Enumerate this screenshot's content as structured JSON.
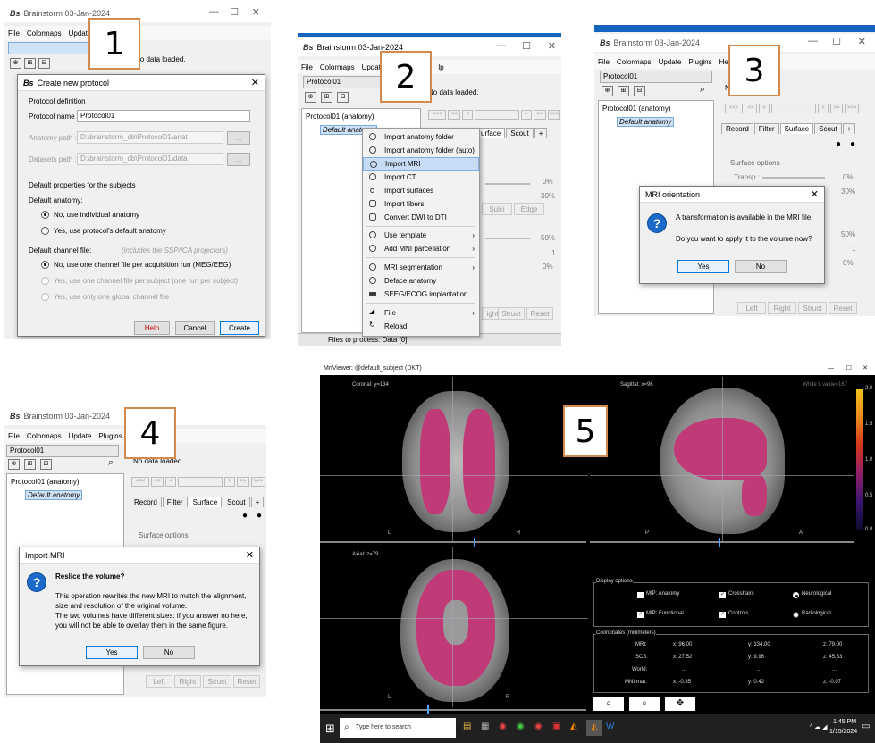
{
  "panel1": {
    "app_title": "Brainstorm 03-Jan-2024",
    "logo": "Bs",
    "menu": [
      "File",
      "Colormaps",
      "Update"
    ],
    "no_data": "No data loaded.",
    "step": "1",
    "dialog": {
      "title": "Create new protocol",
      "section1": "Protocol definition",
      "name_label": "Protocol name :",
      "name_value": "Protocol01",
      "anat_label": "Anatomy path :",
      "anat_value": "D:\\brainstorm_db\\Protocol01\\anat",
      "data_label": "Datasets path :",
      "data_value": "D:\\brainstorm_db\\Protocol01\\data",
      "browse": "...",
      "section2": "Default properties for the subjects",
      "default_anatomy": "Default anatomy:",
      "anat_opt1": "No, use individual anatomy",
      "anat_opt2": "Yes, use protocol's default anatomy",
      "default_channel": "Default channel file:",
      "channel_note": "(includes the SSP/ICA projectors)",
      "chan_opt1": "No, use one channel file per acquisition run (MEG/EEG)",
      "chan_opt2": "Yes, use one channel file per subject  (one run per subject)",
      "chan_opt3": "Yes, use only one global channel file",
      "help": "Help",
      "cancel": "Cancel",
      "create": "Create"
    }
  },
  "panel2": {
    "app_title": "Brainstorm 03-Jan-2024",
    "menu": [
      "File",
      "Colormaps",
      "Update",
      "lp"
    ],
    "protocol": "Protocol01",
    "no_data": "No data loaded.",
    "tree_root": "Protocol01 (anatomy)",
    "tree_child": "Default anatomy",
    "tabs": [
      "urface",
      "Scout",
      "+"
    ],
    "pct": [
      "0%",
      "30%",
      "50%",
      "1",
      "0%"
    ],
    "btns": [
      "Sulci",
      "Edge",
      "ight",
      "Struct",
      "Reset"
    ],
    "files_status": "Files to process: Data [0]",
    "step": "2",
    "context_menu": [
      "Import anatomy folder",
      "Import anatomy folder (auto)",
      "Import MRI",
      "Import CT",
      "Import surfaces",
      "Import fibers",
      "Convert DWI to DTI",
      "Use template",
      "Add MNI parcellation",
      "MRI segmentation",
      "Deface anatomy",
      "SEEG/ECOG implantation",
      "File",
      "Reload"
    ]
  },
  "panel3": {
    "app_title": "Brainstorm 03-Jan-2024",
    "menu": [
      "File",
      "Colormaps",
      "Update",
      "Plugins",
      "Help"
    ],
    "protocol": "Protocol01",
    "no_data": "No",
    "tree_root": "Protocol01 (anatomy)",
    "tree_child": "Default anatomy",
    "tabs": [
      "Record",
      "Filter",
      "Surface",
      "Scout",
      "+"
    ],
    "surface_options": "Surface options",
    "transp": "Transp.:",
    "pct": [
      "0%",
      "30%",
      "50%",
      "1",
      "0%"
    ],
    "btns": [
      "Left",
      "Right",
      "Struct",
      "Reset"
    ],
    "step": "3",
    "dialog": {
      "title": "MRI orientation",
      "line1": "A transformation is available in the MRI file.",
      "line2": "Do you want to apply it to the volume now?",
      "yes": "Yes",
      "no": "No"
    }
  },
  "panel4": {
    "app_title": "Brainstorm 03-Jan-2024",
    "menu": [
      "File",
      "Colormaps",
      "Update",
      "Plugins"
    ],
    "protocol": "Protocol01",
    "no_data": "No data loaded.",
    "tree_root": "Protocol01 (anatomy)",
    "tree_child": "Default anatomy",
    "tabs": [
      "Record",
      "Filter",
      "Surface",
      "Scout",
      "+"
    ],
    "surface_options": "Surface options",
    "btns": [
      "Left",
      "Right",
      "Struct",
      "Reset"
    ],
    "step": "4",
    "dialog": {
      "title": "Import MRI",
      "heading": "Reslice the volume?",
      "line1": "This operation rewrites the new MRI to match the alignment,",
      "line2": "size and resolution of the original volume.",
      "line3": "The two volumes have different sizes: if you answer no here,",
      "line4": "you will not be able to overlay them in the same figure.",
      "yes": "Yes",
      "no": "No"
    }
  },
  "panel5": {
    "window_title": "MriViewer: @default_subject (DKT)",
    "step": "5",
    "coronal": "Coronal:  y=134",
    "sagittal": "Sagittal:  x=96",
    "axial": "Axial:  z=79",
    "value_readout": "White L  value=167",
    "colorbar_ticks": [
      "2.0",
      "1.5",
      "1.0",
      "0.5",
      "0.0"
    ],
    "orient": {
      "L": "L",
      "R": "R",
      "P": "P",
      "A": "A"
    },
    "display_options": "Display options",
    "opts": {
      "mip_anat": "MIP: Anatomy",
      "crosshairs": "Crosshairs",
      "neuro": "Neurological",
      "mip_func": "MIP: Functional",
      "controls": "Controls",
      "radio": "Radiological"
    },
    "coords_title": "Coordinates (millimeters)",
    "coords": [
      {
        "label": "MRI:",
        "x": "x: 96.00",
        "y": "y: 134.00",
        "z": "z: 79.00"
      },
      {
        "label": "SCS:",
        "x": "x: 27.52",
        "y": "y: 9.96",
        "z": "z: 45.33"
      },
      {
        "label": "World:",
        "x": "...",
        "y": "...",
        "z": "..."
      },
      {
        "label": "MNI-mat:",
        "x": "x: -0.35",
        "y": "y: 0.42",
        "z": "z: -0.07"
      }
    ]
  },
  "taskbar": {
    "search": "Type here to search",
    "time": "1:45 PM",
    "date": "1/15/2024"
  }
}
